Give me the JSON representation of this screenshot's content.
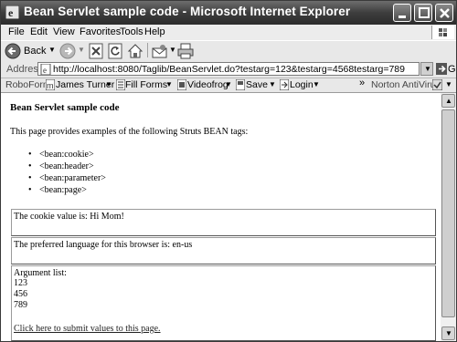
{
  "window": {
    "title": "Bean Servlet sample code - Microsoft Internet Explorer"
  },
  "menu": [
    "File",
    "Edit",
    "View",
    "Favorites",
    "Tools",
    "Help"
  ],
  "toolbar": {
    "back_label": "Back"
  },
  "address": {
    "label": "Address",
    "url": "http://localhost:8080/Taglib/BeanServlet.do?testarg=123&testarg=4568testarg=789",
    "go_label": "Go"
  },
  "links": {
    "roboform": "RoboForm",
    "james": "James Turner",
    "fill": "Fill Forms",
    "videofrog": "Videofrog",
    "save": "Save",
    "login": "Login",
    "more": "»",
    "norton": "Norton AntiVirus"
  },
  "page": {
    "heading": "Bean Servlet sample code",
    "intro": "This page provides examples of the following Struts BEAN tags:",
    "tags": [
      "<bean:cookie>",
      "<bean:header>",
      "<bean:parameter>",
      "<bean:page>"
    ],
    "cookie_text": "The cookie value is: Hi Mom!",
    "language_text": "The preferred language for this browser is: en-us",
    "args_label": "Argument list:",
    "args": [
      "123",
      "456",
      "789"
    ],
    "submit_link": "Click here to submit values to this page."
  }
}
